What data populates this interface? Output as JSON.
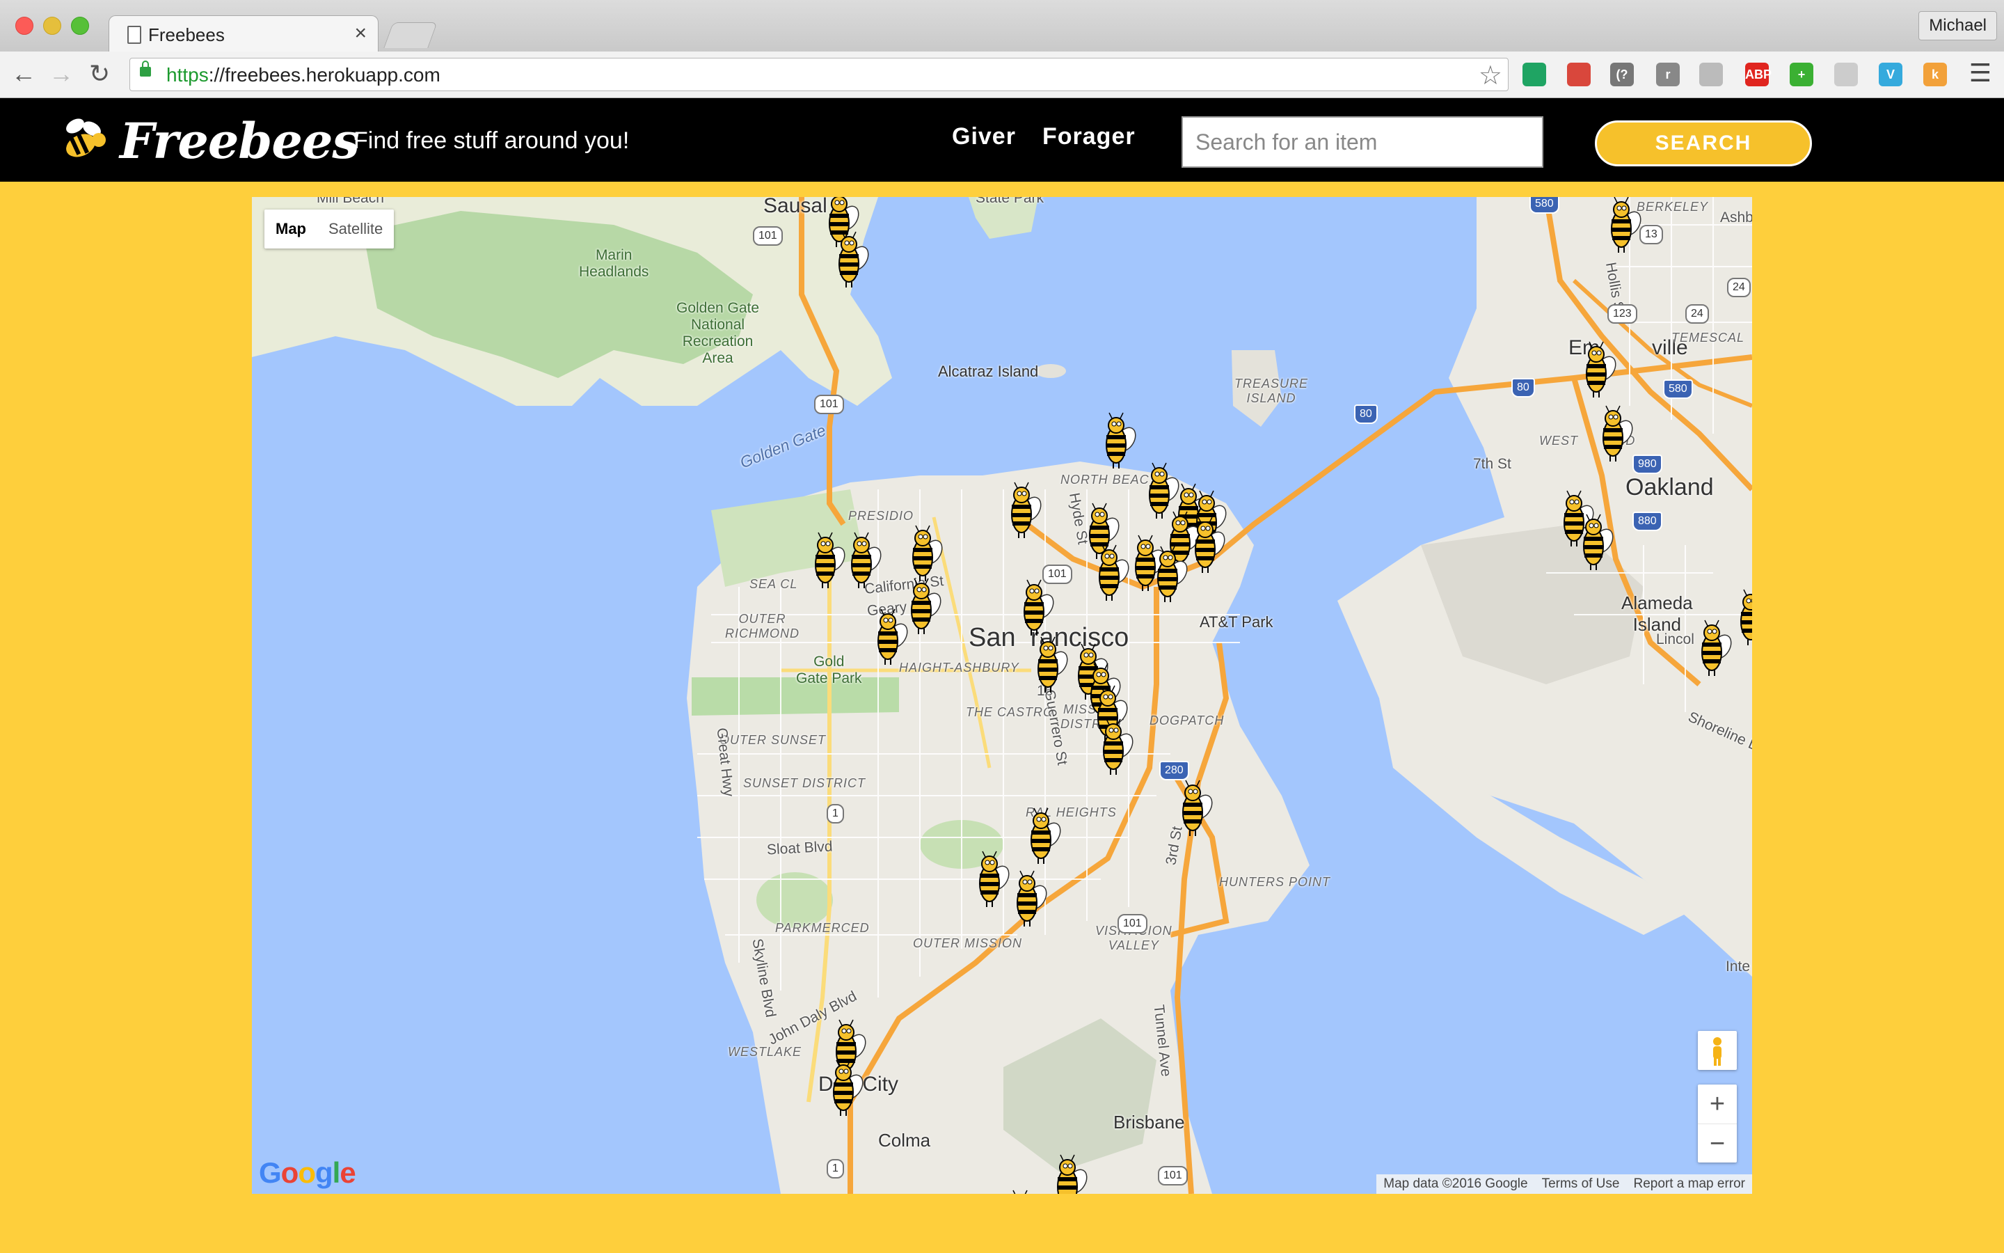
{
  "browser": {
    "tab_title": "Freebees",
    "tab_close": "×",
    "profile_name": "Michael",
    "url_scheme": "https",
    "url_rest": "://freebees.herokuapp.com",
    "extensions": [
      {
        "icon": "google-drive-icon",
        "text": "",
        "color": "#1fa463"
      },
      {
        "icon": "bookmark-red-icon",
        "text": "",
        "color": "#d9473c"
      },
      {
        "icon": "wifi-question-icon",
        "text": "(?",
        "color": "#777777"
      },
      {
        "icon": "readability-icon",
        "text": "r",
        "color": "#888888"
      },
      {
        "icon": "drive-grey-icon",
        "text": "",
        "color": "#bbbbbb"
      },
      {
        "icon": "adblock-plus-icon",
        "text": "ABP",
        "color": "#e0251f"
      },
      {
        "icon": "green-plus-icon",
        "text": "+",
        "color": "#3bb033"
      },
      {
        "icon": "circle-grey-icon",
        "text": "",
        "color": "#cccccc"
      },
      {
        "icon": "vimeo-blue-icon",
        "text": "V",
        "color": "#35aadd"
      },
      {
        "icon": "orange-k-icon",
        "text": "k",
        "color": "#f2a13a"
      }
    ]
  },
  "app": {
    "brand": "Freebees",
    "tagline": "Find free stuff around you!",
    "nav": [
      "Giver",
      "Forager"
    ],
    "search_placeholder": "Search for an item",
    "search_button": "SEARCH",
    "accent_color": "#fecf3c"
  },
  "map": {
    "type_controls": {
      "map": "Map",
      "satellite": "Satellite"
    },
    "zoom_in": "+",
    "zoom_out": "−",
    "google_logo": "Google",
    "attribution": [
      "Map data ©2016 Google",
      "Terms of Use",
      "Report a map error"
    ],
    "labels": {
      "sausalito": "Sausal",
      "state_park": "State Park",
      "mill_beach": "Mill Beach",
      "marin_headlands": "Marin\nHeadlands",
      "ggnra": "Golden Gate\nNational\nRecreation\nArea",
      "alcatraz": "Alcatraz Island",
      "golden_gate": "Golden Gate",
      "treasure_island": "TREASURE\nISLAND",
      "berkeley": "BERKELEY",
      "ashby": "Ashby",
      "hollis": "Hollis St",
      "emeryville": "Em         ville",
      "temescal": "TEMESCAL",
      "west_oakland": "WEST       AND",
      "seventh": "7th St",
      "oakland": "Oakland",
      "presidio": "PRESIDIO",
      "north_beach": "NORTH BEAC",
      "sea_cliff": "SEA CL",
      "california": "California St",
      "geary": "Geary Blvd",
      "outer_richmond": "OUTER\nRICHMOND",
      "golden_gate_park": "Gold\nGate Park",
      "haight": "HAIGHT-ASHBURY",
      "san_francisco": "San  rancisco",
      "att_park": "AT&T Park",
      "alameda": "Alameda\nIsland",
      "lincoln": "Lincol",
      "shoreline": "Shoreline Dr",
      "the_castro": "THE CASTRO",
      "mission": "MISSION\nDISTRICT",
      "dogpatch": "DOGPATCH",
      "outer_sunset": "OUTER SUNSET",
      "sunset_district": "SUNSET DISTRICT",
      "great_hwy": "Great Hwy",
      "sloat": "Sloat Blvd",
      "bernal": "RAL HEIGHTS",
      "third_st": "3rd St",
      "hunters_point": "HUNTERS POINT",
      "parkmerced": "PARKMERCED",
      "outer_mission": "OUTER MISSION",
      "visitacion": "VISITACION\nVALLEY",
      "skyline": "Skyline Blvd",
      "john_daly": "John Daly Blvd",
      "westlake": "WESTLAKE",
      "daly_city": "D     City",
      "colma": "Colma",
      "brisbane": "Brisbane",
      "tunnel_ave": "Tunnel Ave",
      "inte": "Inte",
      "hyde": "Hyde St",
      "guerrero": "Guerrero St",
      "sixteenth": "16"
    },
    "shields": [
      "101",
      "101",
      "101",
      "101",
      "101",
      "1",
      "1",
      "80",
      "80",
      "580",
      "580",
      "980",
      "880",
      "24",
      "24",
      "123",
      "13",
      "280"
    ]
  }
}
